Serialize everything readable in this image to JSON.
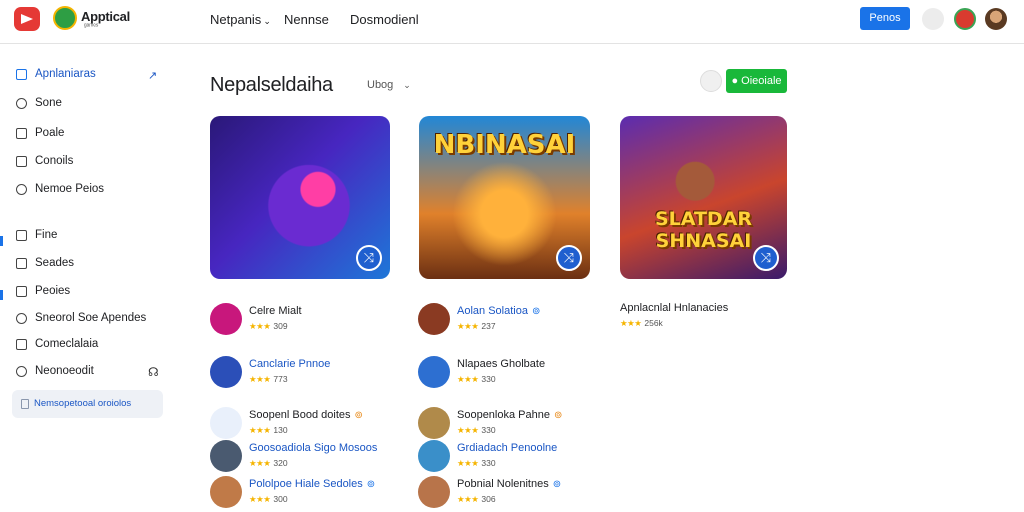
{
  "header": {
    "brand": "Apptical",
    "brand_sub": "ᵍᵃᵐᵉˢ",
    "nav": [
      "Netpanis",
      "Nennse",
      "Dosmodienl"
    ],
    "button_label": "Penos"
  },
  "sidebar": {
    "items": [
      {
        "label": "Apnlaniaras",
        "icon": "grid-icon"
      },
      {
        "label": "Sone",
        "icon": "circle-arrow-icon"
      },
      {
        "label": "Poale",
        "icon": "square-icon"
      },
      {
        "label": "Conoils",
        "icon": "square-icon"
      },
      {
        "label": "Nemoe Peios",
        "icon": "circle-plus-icon"
      },
      {
        "label": "Fine",
        "icon": "chart-icon"
      },
      {
        "label": "Seades",
        "icon": "square-icon"
      },
      {
        "label": "Peoies",
        "icon": "square-icon"
      },
      {
        "label": "Sneorol Soe Apendes",
        "icon": "search-icon"
      },
      {
        "label": "Comeclalaia",
        "icon": "list-icon"
      },
      {
        "label": "Neonoeodit",
        "icon": "heart-icon"
      }
    ],
    "footer_box": "Nemsopetooal oroiolos"
  },
  "main": {
    "title": "Nepalseldaiha",
    "filter_label": "Ubog",
    "action_label": "Oieoiale",
    "featured": [
      {
        "art_text": ""
      },
      {
        "art_text": "NBINASAI"
      },
      {
        "art_text": "SLATDAR SHNASAI"
      }
    ],
    "col1": [
      {
        "name": "Celre Mialt",
        "rating": "309",
        "verified": false,
        "blue": false,
        "icon_color": "#c8177c"
      },
      {
        "name": "Canclarie Pnnoe",
        "rating": "773",
        "verified": false,
        "blue": true,
        "icon_color": "#2b4fb8"
      },
      {
        "name": "Soopenl Bood doites",
        "rating": "130",
        "verified": "orange",
        "blue": false,
        "icon_color": "#e9f0fb"
      },
      {
        "name": "Goosoadiola Sigo Mosoos",
        "rating": "320",
        "verified": false,
        "blue": true,
        "icon_color": "#4a5a70"
      },
      {
        "name": "Pololpoe Hiale Sedoles",
        "rating": "300",
        "verified": "blue",
        "blue": true,
        "icon_color": "#c07a48"
      }
    ],
    "col2": [
      {
        "name": "Aolan Solatioa",
        "rating": "237",
        "verified": "blue",
        "blue": true,
        "icon_color": "#8a3a22"
      },
      {
        "name": "Nlapaes Gholbate",
        "rating": "330",
        "verified": false,
        "blue": false,
        "icon_color": "#2d6fd1"
      },
      {
        "name": "Soopenloka Pahne",
        "rating": "330",
        "verified": "orange",
        "blue": false,
        "icon_color": "#b08a4a"
      },
      {
        "name": "Grdiadach Penoolne",
        "rating": "330",
        "verified": false,
        "blue": true,
        "icon_color": "#3a8fc9"
      },
      {
        "name": "Pobnial Nolenitnes",
        "rating": "306",
        "verified": "blue",
        "blue": false,
        "icon_color": "#b8744a"
      }
    ],
    "col3": [
      {
        "name": "Apnlacnlal Hnlanacies",
        "rating": "256k"
      }
    ]
  }
}
